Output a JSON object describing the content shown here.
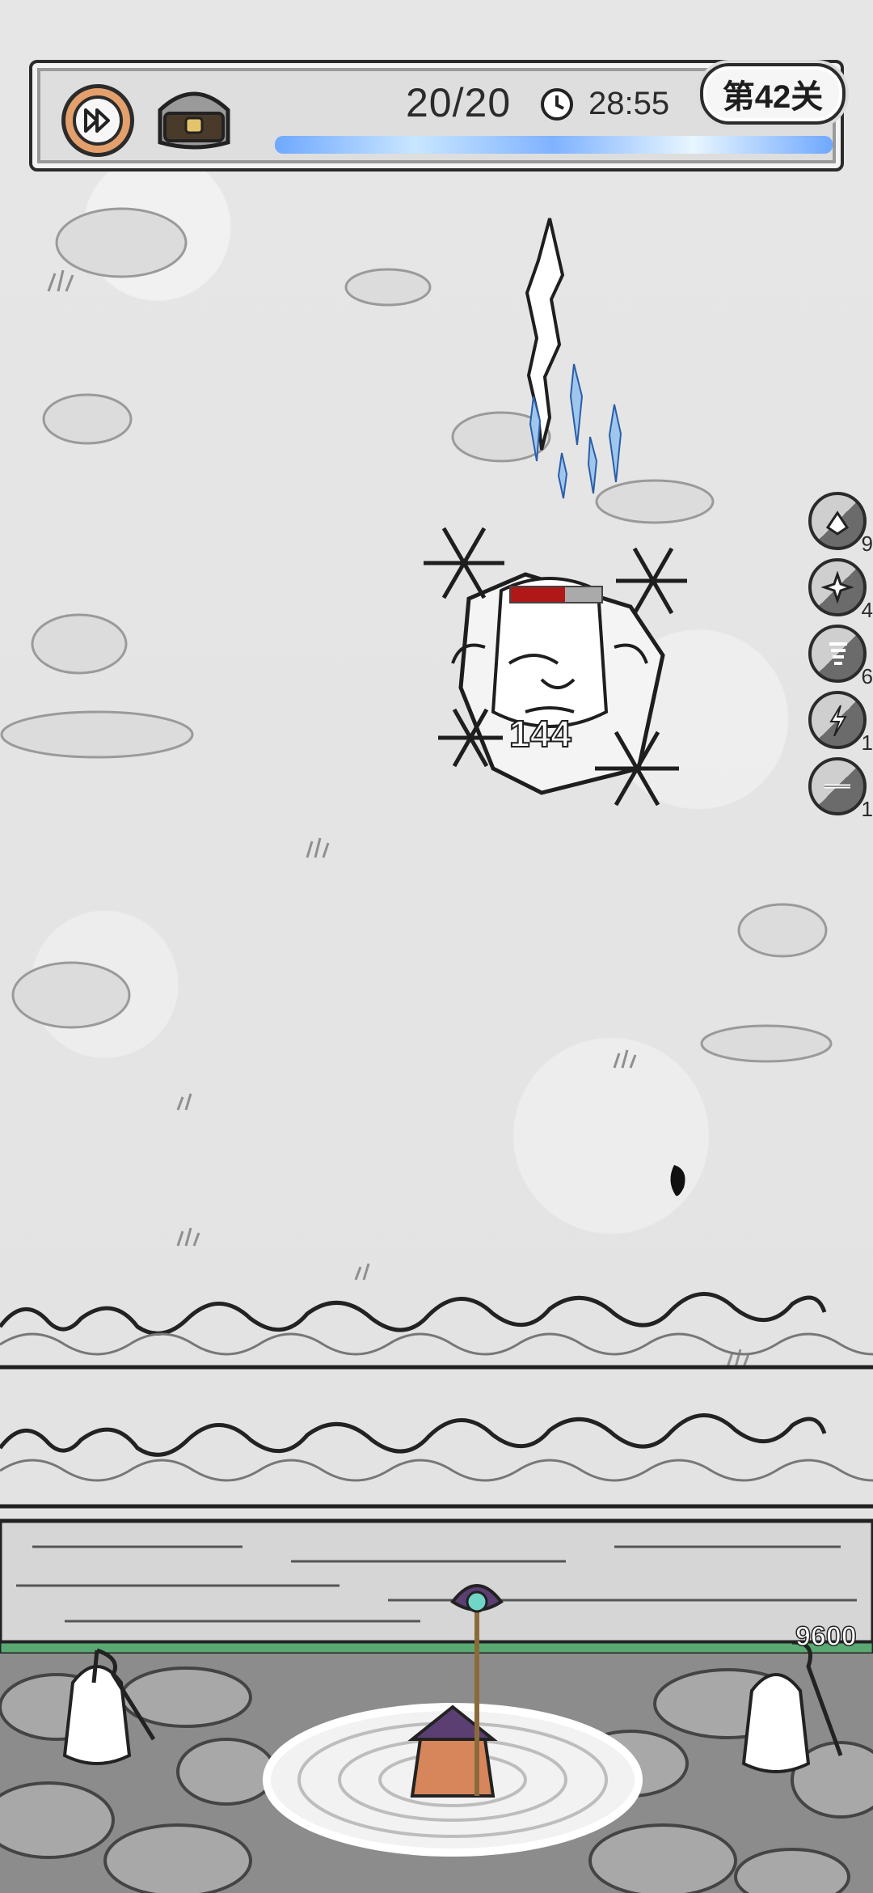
{
  "hud": {
    "wave_counter": "20/20",
    "timer": "28:55",
    "level": "第42关",
    "progress_fraction": 1.0
  },
  "battle": {
    "boss_hp_fraction": 0.6,
    "damage_number": "144"
  },
  "skills": [
    {
      "name": "ice-crystal-skill",
      "count": "9"
    },
    {
      "name": "frost-burst-skill",
      "count": "4"
    },
    {
      "name": "whirlwind-skill",
      "count": "6"
    },
    {
      "name": "lightning-skill",
      "count": "1"
    },
    {
      "name": "blade-skill",
      "count": "1"
    }
  ],
  "base": {
    "wall_hp": "9600"
  },
  "colors": {
    "speed_button": "#e3a06c",
    "hp_bar": "#b01818",
    "wall_bar": "#5aa872",
    "mage_robe": "#d6865a",
    "mage_hat": "#5b3f73"
  }
}
